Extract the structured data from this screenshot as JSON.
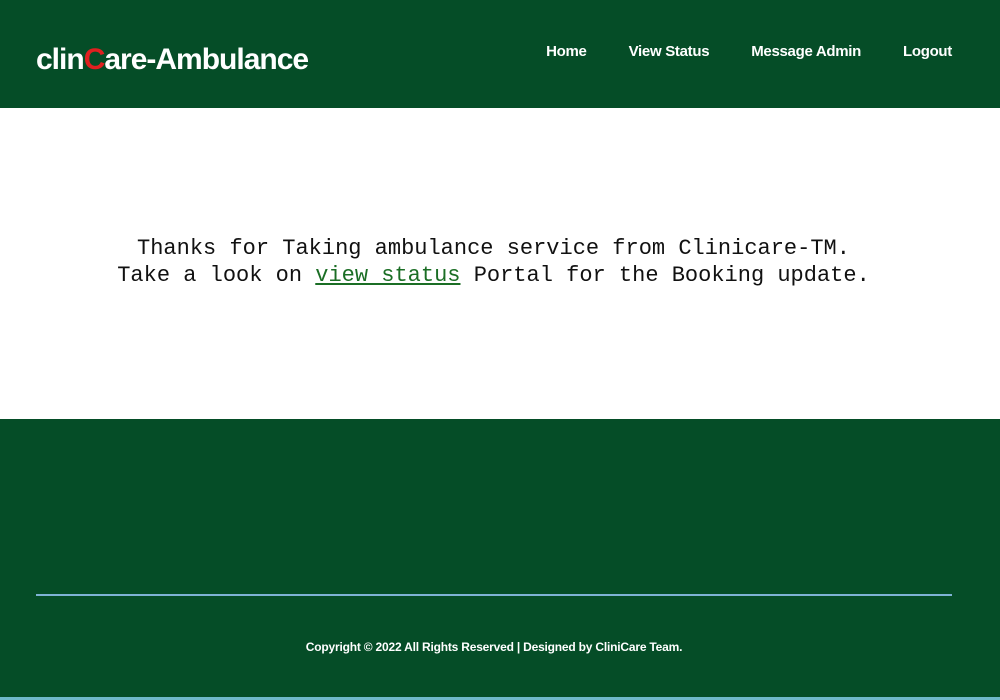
{
  "header": {
    "brand_prefix": "clin",
    "brand_accent": "C",
    "brand_suffix": "are-Ambulance",
    "nav": {
      "home": "Home",
      "view_status": "View Status",
      "message_admin": "Message Admin",
      "logout": "Logout"
    }
  },
  "main": {
    "line1": "Thanks for Taking ambulance service from Clinicare-TM.",
    "line2_prefix": "Take a look on ",
    "line2_link": "view status",
    "line2_suffix": " Portal for the Booking update."
  },
  "footer": {
    "copyright": "Copyright © 2022 All Rights Reserved | Designed by CliniCare Team."
  },
  "colors": {
    "primary": "#054d27",
    "accent": "#e02020",
    "link": "#1b6e25",
    "divider": "#7fb3d5"
  }
}
